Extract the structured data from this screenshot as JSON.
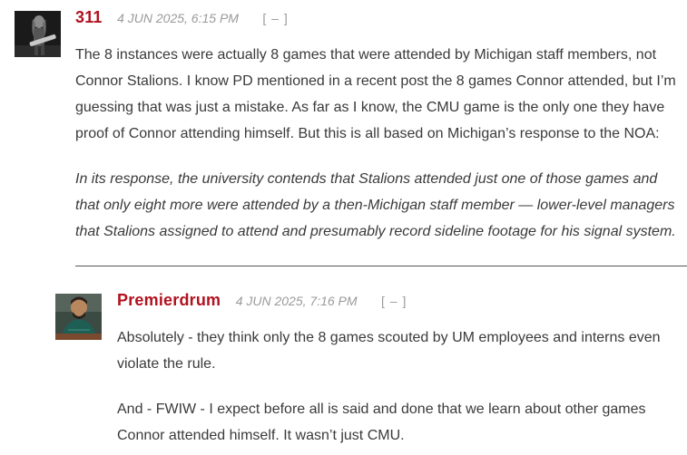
{
  "comments": [
    {
      "author": "311",
      "date": "4 JUN 2025, 6:15 PM",
      "collapse": "[ – ]",
      "paragraphs": [
        "The 8 instances were actually 8 games that were attended by Michigan staff members, not Connor Stalions. I know PD mentioned in a recent post the 8 games Connor attended, but I’m guessing that was just a mistake. As far as I know, the CMU game is the only one they have proof of Connor attending himself. But this is all based on Michigan’s response to the NOA:"
      ],
      "quote": "In its response, the university contends that Stalions attended just one of those games and that only eight more were attended by a then-Michigan staff member — lower-level managers that Stalions assigned to attend and presumably record sideline footage for his signal system."
    },
    {
      "author": "Premierdrum",
      "date": "4 JUN 2025, 7:16 PM",
      "collapse": "[ – ]",
      "paragraphs": [
        "Absolutely - they think only the 8 games scouted by UM employees and interns even violate the rule.",
        "And - FWIW - I expect before all is said and done that we learn about other games Connor attended himself. It wasn’t just CMU."
      ]
    }
  ],
  "colors": {
    "author": "#b1121f",
    "meta": "#9a9a9a",
    "text": "#3a3a3a",
    "divider": "#555555"
  }
}
